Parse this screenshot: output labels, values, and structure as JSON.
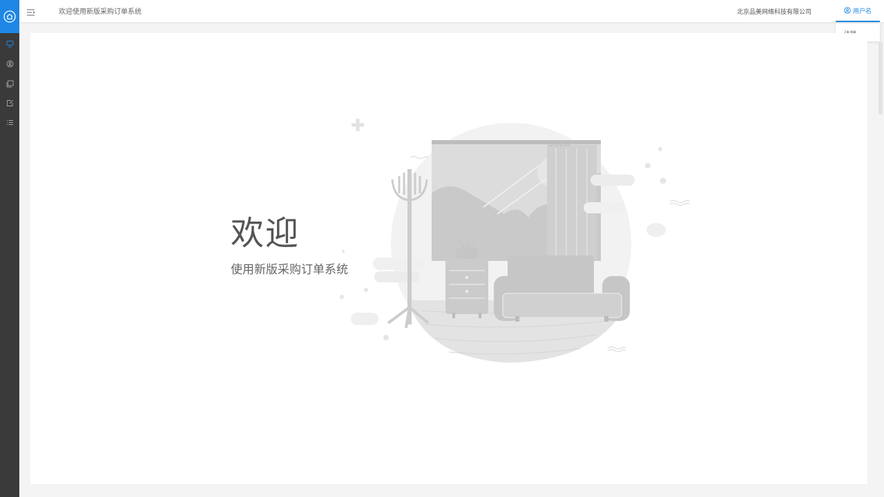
{
  "header": {
    "title": "欢迎使用新版采购订单系统",
    "company": "北京品美网络科技有限公司",
    "user_label": "用户名"
  },
  "user_menu": {
    "items": [
      {
        "label": "注销"
      }
    ]
  },
  "sidebar": {
    "items": [
      {
        "icon": "monitor-icon"
      },
      {
        "icon": "user-circle-icon"
      },
      {
        "icon": "gallery-icon"
      },
      {
        "icon": "document-edit-icon"
      },
      {
        "icon": "list-icon"
      }
    ]
  },
  "welcome": {
    "title": "欢迎",
    "subtitle": "使用新版采购订单系统"
  },
  "colors": {
    "accent": "#1e87e5",
    "sidebar_bg": "#3a3a3a",
    "illustration_gray": "#c8c8c8"
  }
}
